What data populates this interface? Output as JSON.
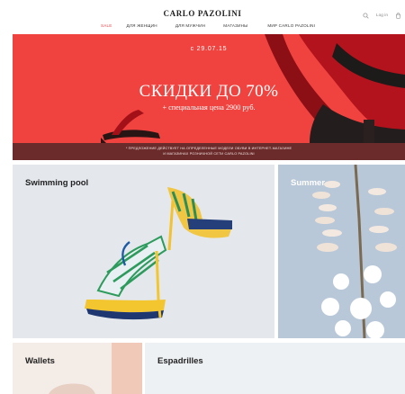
{
  "header": {
    "logo": "CARLO PAZOLINI",
    "nav": [
      "SALE",
      "ДЛЯ ЖЕНЩИН",
      "ДЛЯ МУЖЧИН",
      "МАГАЗИНЫ",
      "МИР CARLO PAZOLINI"
    ],
    "login_label": "Log in",
    "icons": [
      "search-icon",
      "cart-icon"
    ]
  },
  "hero": {
    "date": "с 29.07.15",
    "headline": "СКИДКИ ДО 70%",
    "subline": "+ специальная цена 2900 руб.",
    "disclaimer_line1": "* ПРЕДЛОЖЕНИЕ ДЕЙСТВУЕТ НА ОПРЕДЕЛЕННЫЕ МОДЕЛИ ОБУВИ В ИНТЕРНЕТ-МАГАЗИНЕ",
    "disclaimer_line2": "И МАГАЗИНАХ РОЗНИЧНОЙ СЕТИ CARLO PAZOLINI",
    "colors": {
      "background": "#f0433f",
      "shoe": "#b3131c"
    }
  },
  "tiles": [
    {
      "title": "Swimming pool"
    },
    {
      "title": "Summer"
    },
    {
      "title": "Wallets"
    },
    {
      "title": "Espadrilles"
    }
  ]
}
